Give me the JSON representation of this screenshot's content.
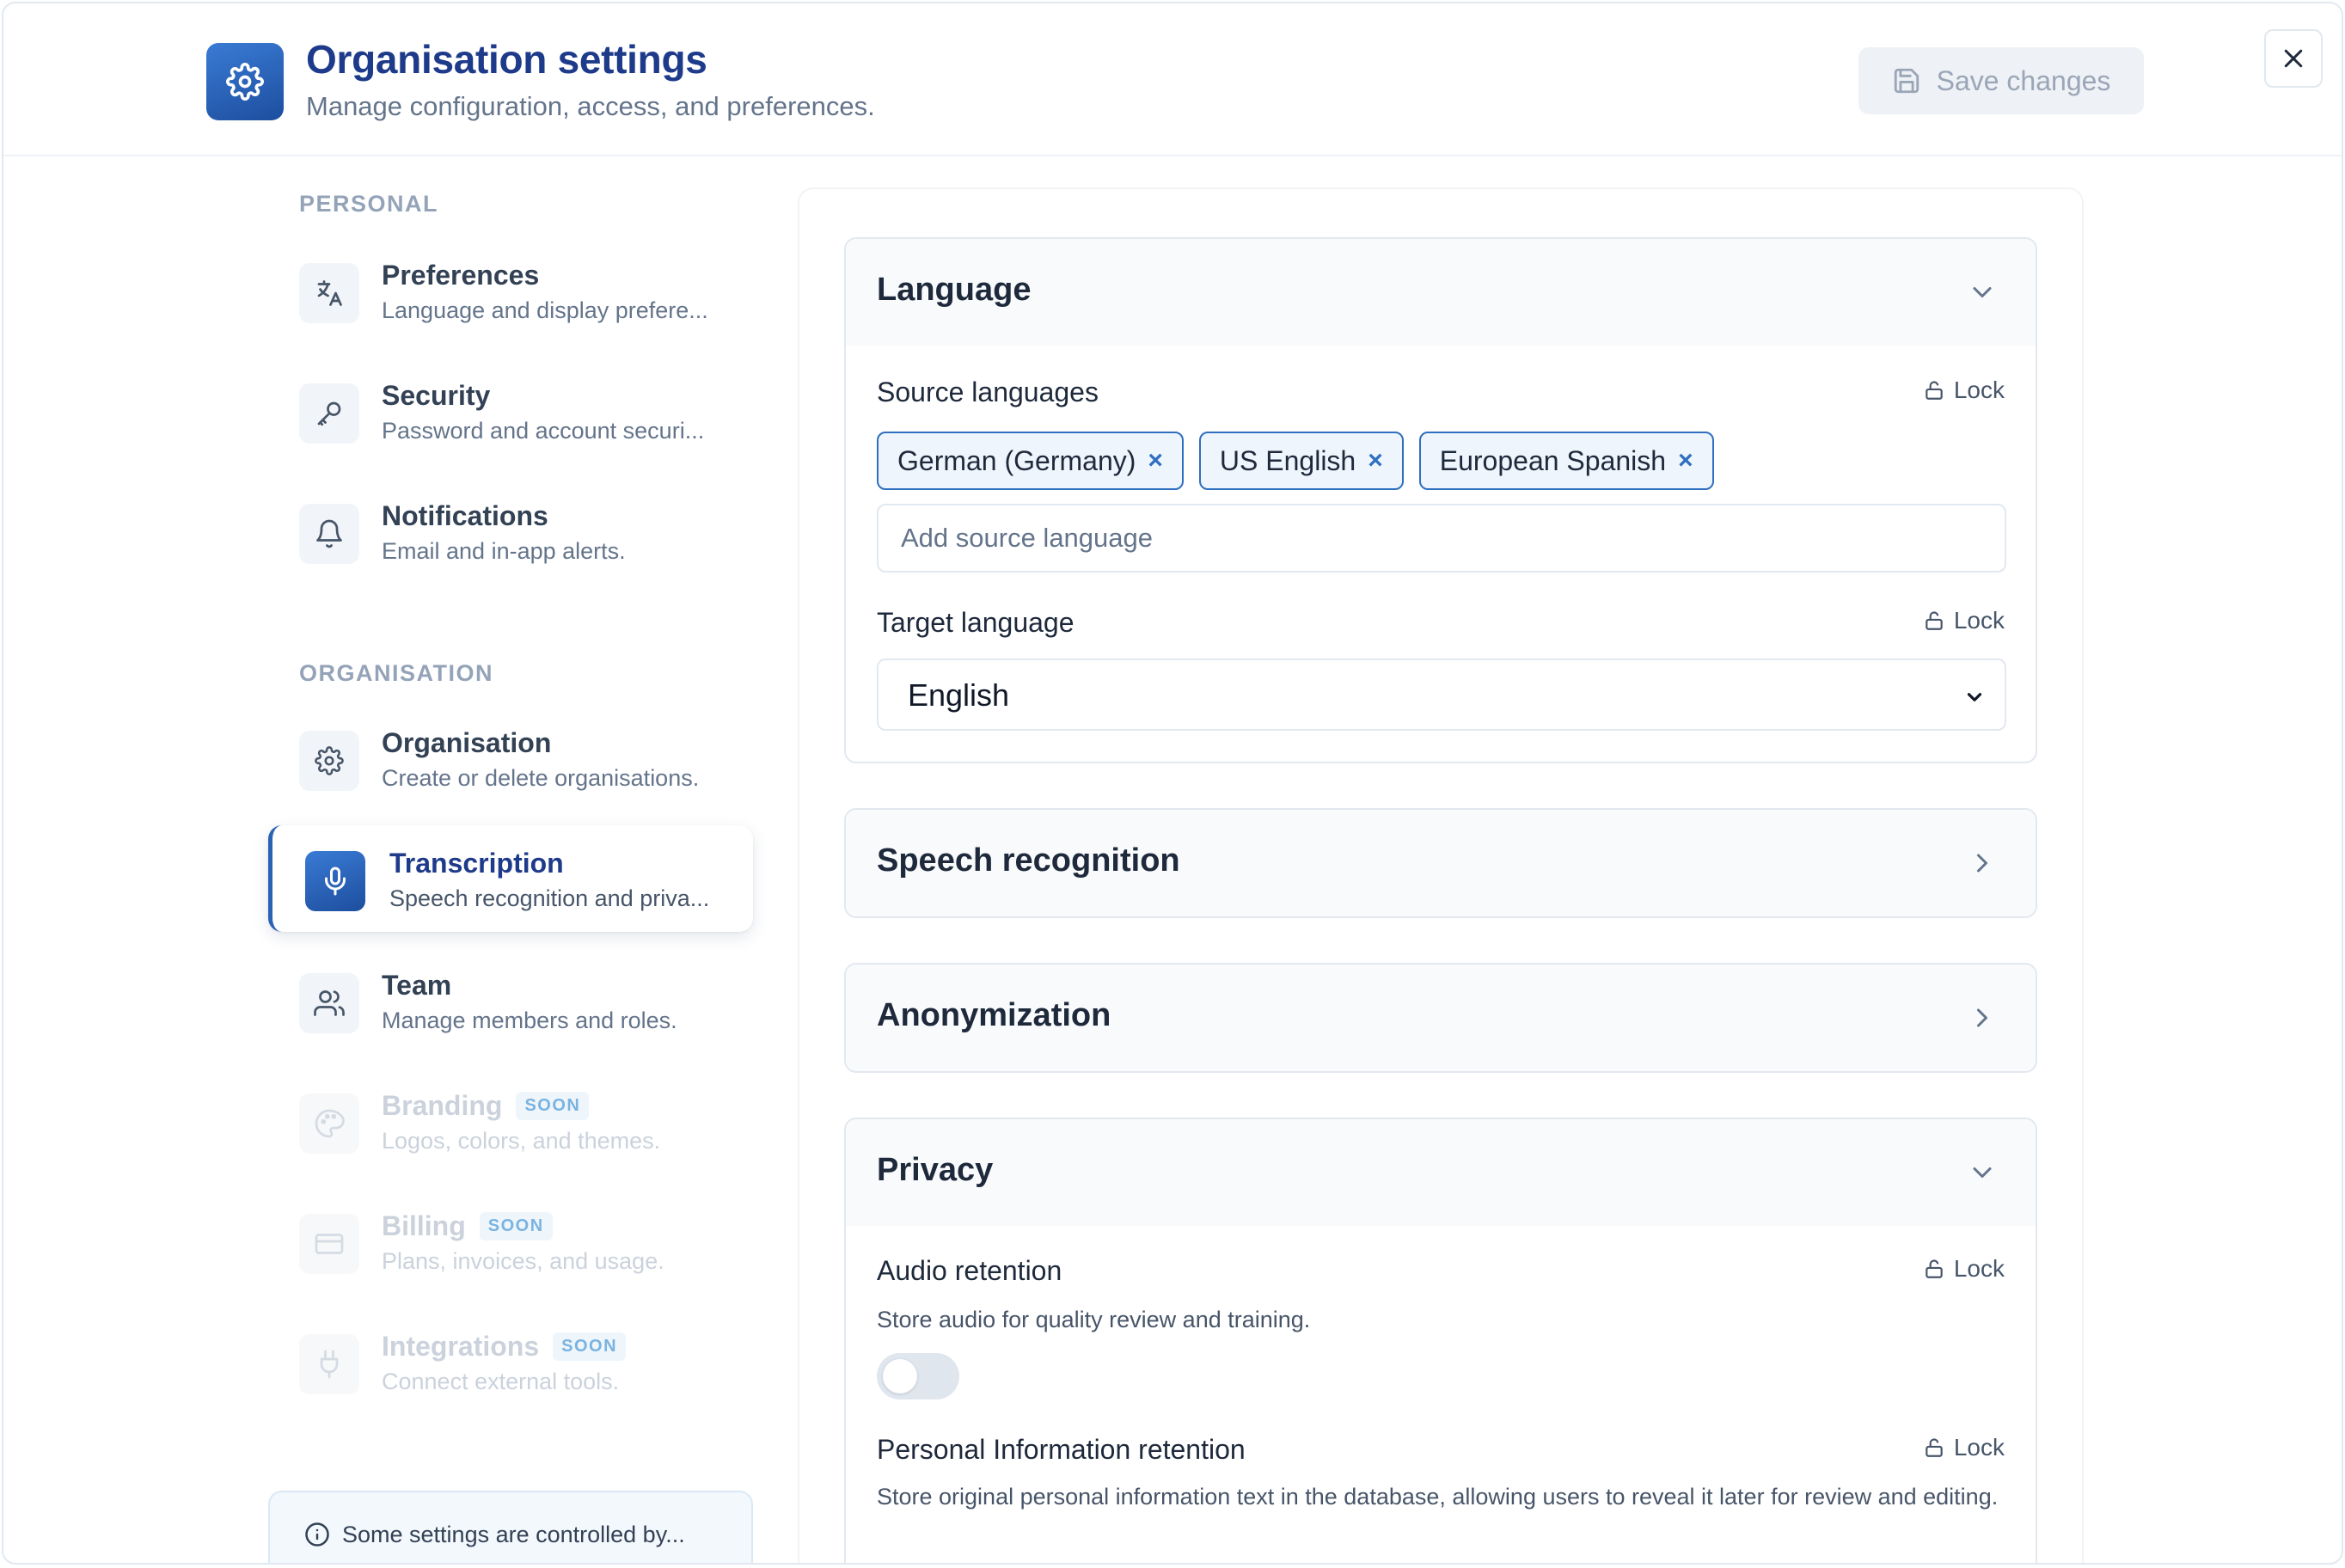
{
  "header": {
    "title": "Organisation settings",
    "subtitle": "Manage configuration, access, and preferences.",
    "save_label": "Save changes"
  },
  "sidebar": {
    "personal_label": "PERSONAL",
    "organisation_label": "ORGANISATION",
    "items": [
      {
        "label": "Preferences",
        "description": "Language and display prefere...",
        "icon": "translate-icon"
      },
      {
        "label": "Security",
        "description": "Password and account securi...",
        "icon": "key-icon"
      },
      {
        "label": "Notifications",
        "description": "Email and in-app alerts.",
        "icon": "bell-icon"
      },
      {
        "label": "Organisation",
        "description": "Create or delete organisations.",
        "icon": "gear-icon"
      },
      {
        "label": "Transcription",
        "description": "Speech recognition and priva...",
        "icon": "microphone-icon",
        "active": true
      },
      {
        "label": "Team",
        "description": "Manage members and roles.",
        "icon": "users-icon"
      },
      {
        "label": "Branding",
        "description": "Logos, colors, and themes.",
        "icon": "palette-icon",
        "badge": "SOON",
        "disabled": true
      },
      {
        "label": "Billing",
        "description": "Plans, invoices, and usage.",
        "icon": "credit-card-icon",
        "badge": "SOON",
        "disabled": true
      },
      {
        "label": "Integrations",
        "description": "Connect external tools.",
        "icon": "plug-icon",
        "badge": "SOON",
        "disabled": true
      }
    ],
    "info_text": "Some settings are controlled by..."
  },
  "language": {
    "title": "Language",
    "source_label": "Source languages",
    "lock_label": "Lock",
    "chips": [
      "German (Germany)",
      "US English",
      "European Spanish"
    ],
    "chip_remove": "×",
    "add_placeholder": "Add source language",
    "target_label": "Target language",
    "target_value": "English"
  },
  "speech": {
    "title": "Speech recognition"
  },
  "anonymization": {
    "title": "Anonymization"
  },
  "privacy": {
    "title": "Privacy",
    "audio_label": "Audio retention",
    "audio_help": "Store audio for quality review and training.",
    "audio_enabled": false,
    "pii_label": "Personal Information retention",
    "pii_help": "Store original personal information text in the database, allowing users to reveal it later for review and editing."
  },
  "colors": {
    "accent": "#2b63b4",
    "title": "#1e3a8a",
    "chip_border": "#2f6fbf"
  }
}
